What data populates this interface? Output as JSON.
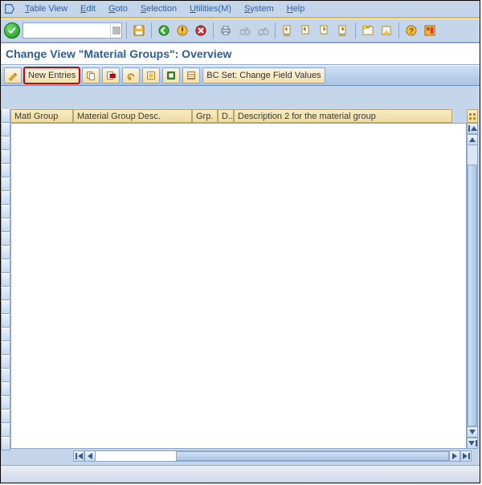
{
  "menu": {
    "table_view_u": "T",
    "table_view_r": "able View",
    "edit_u": "E",
    "edit_r": "dit",
    "goto_u": "G",
    "goto_r": "oto",
    "selection_u": "S",
    "selection_r": "election",
    "utilities_u": "U",
    "utilities_r": "tilities(M)",
    "system_u": "S",
    "system_r": "ystem",
    "help_u": "H",
    "help_r": "elp"
  },
  "title": "Change View \"Material Groups\": Overview",
  "appbar": {
    "new_entries": "New Entries",
    "bc_set": "BC Set: Change Field Values"
  },
  "columns": [
    "Matl Group",
    "Material Group Desc.",
    "Grp.",
    "D...",
    "Description 2 for the material group"
  ],
  "rows": []
}
